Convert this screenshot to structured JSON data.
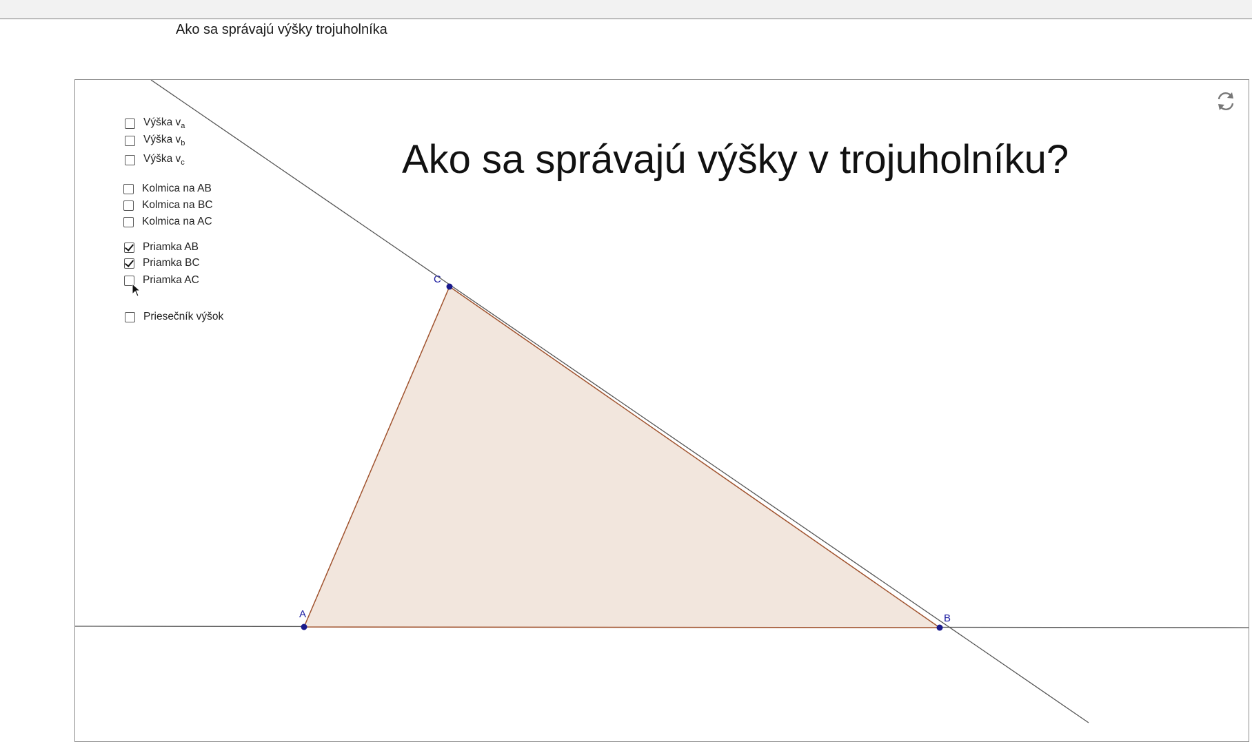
{
  "page": {
    "title": "Ako sa správajú výšky trojuholníka"
  },
  "applet": {
    "heading": "Ako sa správajú výšky v trojuholníku?",
    "reset_icon": "refresh-icon",
    "checkboxes": {
      "vyska_va": {
        "label": "Výška v",
        "sub": "a",
        "checked": false
      },
      "vyska_vb": {
        "label": "Výška v",
        "sub": "b",
        "checked": false
      },
      "vyska_vc": {
        "label": "Výška v",
        "sub": "c",
        "checked": false
      },
      "kolmica_ab": {
        "label": "Kolmica na AB",
        "checked": false
      },
      "kolmica_bc": {
        "label": "Kolmica na BC",
        "checked": false
      },
      "kolmica_ac": {
        "label": "Kolmica na AC",
        "checked": false
      },
      "priamka_ab": {
        "label": "Priamka AB",
        "checked": true
      },
      "priamka_bc": {
        "label": "Priamka BC",
        "checked": true
      },
      "priamka_ac": {
        "label": "Priamka AC",
        "checked": false
      },
      "priesecnik": {
        "label": "Priesečník výšok",
        "checked": false
      }
    },
    "points": {
      "A": "A",
      "B": "B",
      "C": "C"
    },
    "colors": {
      "triangle_fill": "#f2e6dd",
      "triangle_stroke": "#a0522d",
      "line": "#555555",
      "point": "#1a1a8c"
    }
  }
}
